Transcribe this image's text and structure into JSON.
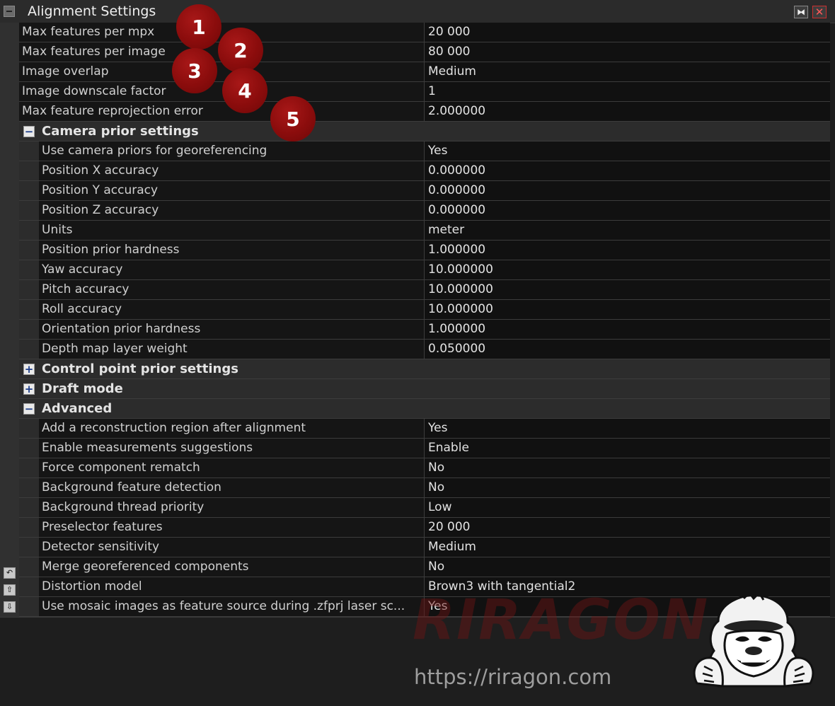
{
  "window": {
    "title": "Alignment Settings",
    "close_glyph": "✕",
    "pin_glyph": "⧓"
  },
  "side_buttons": [
    "↶",
    "⇧",
    "⇩"
  ],
  "top_settings": [
    {
      "name": "Max features per mpx",
      "value": "20 000"
    },
    {
      "name": "Max features per image",
      "value": "80 000"
    },
    {
      "name": "Image overlap",
      "value": "Medium"
    },
    {
      "name": "Image downscale factor",
      "value": "1"
    },
    {
      "name": "Max feature reprojection error",
      "value": "2.000000"
    }
  ],
  "camera_prior": {
    "label": "Camera prior settings",
    "toggle": "−",
    "rows": [
      {
        "name": "Use camera priors for georeferencing",
        "value": "Yes"
      },
      {
        "name": "Position X accuracy",
        "value": "0.000000"
      },
      {
        "name": "Position Y accuracy",
        "value": "0.000000"
      },
      {
        "name": "Position Z accuracy",
        "value": "0.000000"
      },
      {
        "name": "Units",
        "value": "meter"
      },
      {
        "name": "Position prior hardness",
        "value": "1.000000"
      },
      {
        "name": "Yaw accuracy",
        "value": "10.000000"
      },
      {
        "name": "Pitch accuracy",
        "value": "10.000000"
      },
      {
        "name": "Roll accuracy",
        "value": "10.000000"
      },
      {
        "name": "Orientation prior hardness",
        "value": "1.000000"
      },
      {
        "name": "Depth map layer weight",
        "value": "0.050000"
      }
    ]
  },
  "control_point": {
    "label": "Control point prior settings",
    "toggle": "+"
  },
  "draft_mode": {
    "label": "Draft mode",
    "toggle": "+"
  },
  "advanced": {
    "label": "Advanced",
    "toggle": "−",
    "rows": [
      {
        "name": "Add a reconstruction region after alignment",
        "value": "Yes"
      },
      {
        "name": "Enable measurements suggestions",
        "value": "Enable"
      },
      {
        "name": "Force component rematch",
        "value": "No"
      },
      {
        "name": "Background feature detection",
        "value": "No"
      },
      {
        "name": "Background thread priority",
        "value": "Low"
      },
      {
        "name": "Preselector features",
        "value": "20 000"
      },
      {
        "name": "Detector sensitivity",
        "value": "Medium"
      },
      {
        "name": "Merge georeferenced components",
        "value": "No"
      },
      {
        "name": "Distortion model",
        "value": "Brown3 with tangential2"
      },
      {
        "name": "Use mosaic images as feature source during .zfprj laser sc...",
        "value": "Yes"
      }
    ]
  },
  "badges": [
    "1",
    "2",
    "3",
    "4",
    "5"
  ],
  "watermark": "RIRAGON",
  "url": "https://riragon.com",
  "colors": {
    "badge": "#9a1010",
    "background": "#1e1e1e",
    "toggle_sign": "#1b3c8a"
  },
  "icons": {
    "mascot": "gorilla-mascot-icon"
  }
}
